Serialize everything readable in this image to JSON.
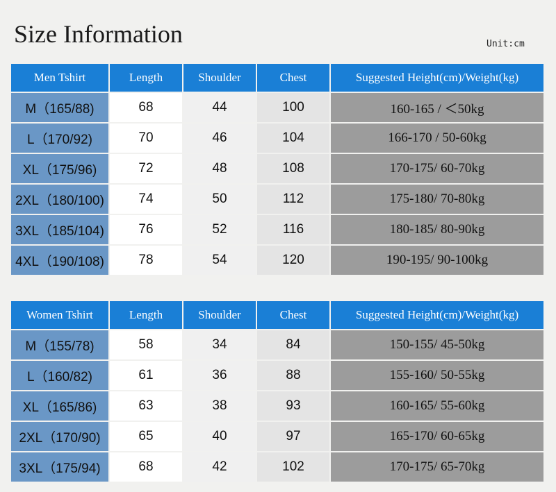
{
  "header": {
    "title": "Size Information",
    "unit": "Unit:cm"
  },
  "men_table": {
    "headers": [
      "Men Tshirt",
      "Length",
      "Shoulder",
      "Chest",
      "Suggested Height(cm)/Weight(kg)"
    ],
    "rows": [
      [
        "M（165/88)",
        "68",
        "44",
        "100",
        "160-165 / ＜50kg"
      ],
      [
        "L（170/92)",
        "70",
        "46",
        "104",
        "166-170 / 50-60kg"
      ],
      [
        "XL（175/96)",
        "72",
        "48",
        "108",
        "170-175/ 60-70kg"
      ],
      [
        "2XL（180/100)",
        "74",
        "50",
        "112",
        "175-180/ 70-80kg"
      ],
      [
        "3XL（185/104)",
        "76",
        "52",
        "116",
        "180-185/ 80-90kg"
      ],
      [
        "4XL（190/108)",
        "78",
        "54",
        "120",
        "190-195/ 90-100kg"
      ]
    ]
  },
  "women_table": {
    "headers": [
      "Women Tshirt",
      "Length",
      "Shoulder",
      "Chest",
      "Suggested Height(cm)/Weight(kg)"
    ],
    "rows": [
      [
        "M（155/78)",
        "58",
        "34",
        "84",
        "150-155/ 45-50kg"
      ],
      [
        "L（160/82)",
        "61",
        "36",
        "88",
        "155-160/ 50-55kg"
      ],
      [
        "XL（165/86)",
        "63",
        "38",
        "93",
        "160-165/ 55-60kg"
      ],
      [
        "2XL（170/90)",
        "65",
        "40",
        "97",
        "165-170/ 60-65kg"
      ],
      [
        "3XL（175/94)",
        "68",
        "42",
        "102",
        "170-175/ 65-70kg"
      ]
    ]
  }
}
